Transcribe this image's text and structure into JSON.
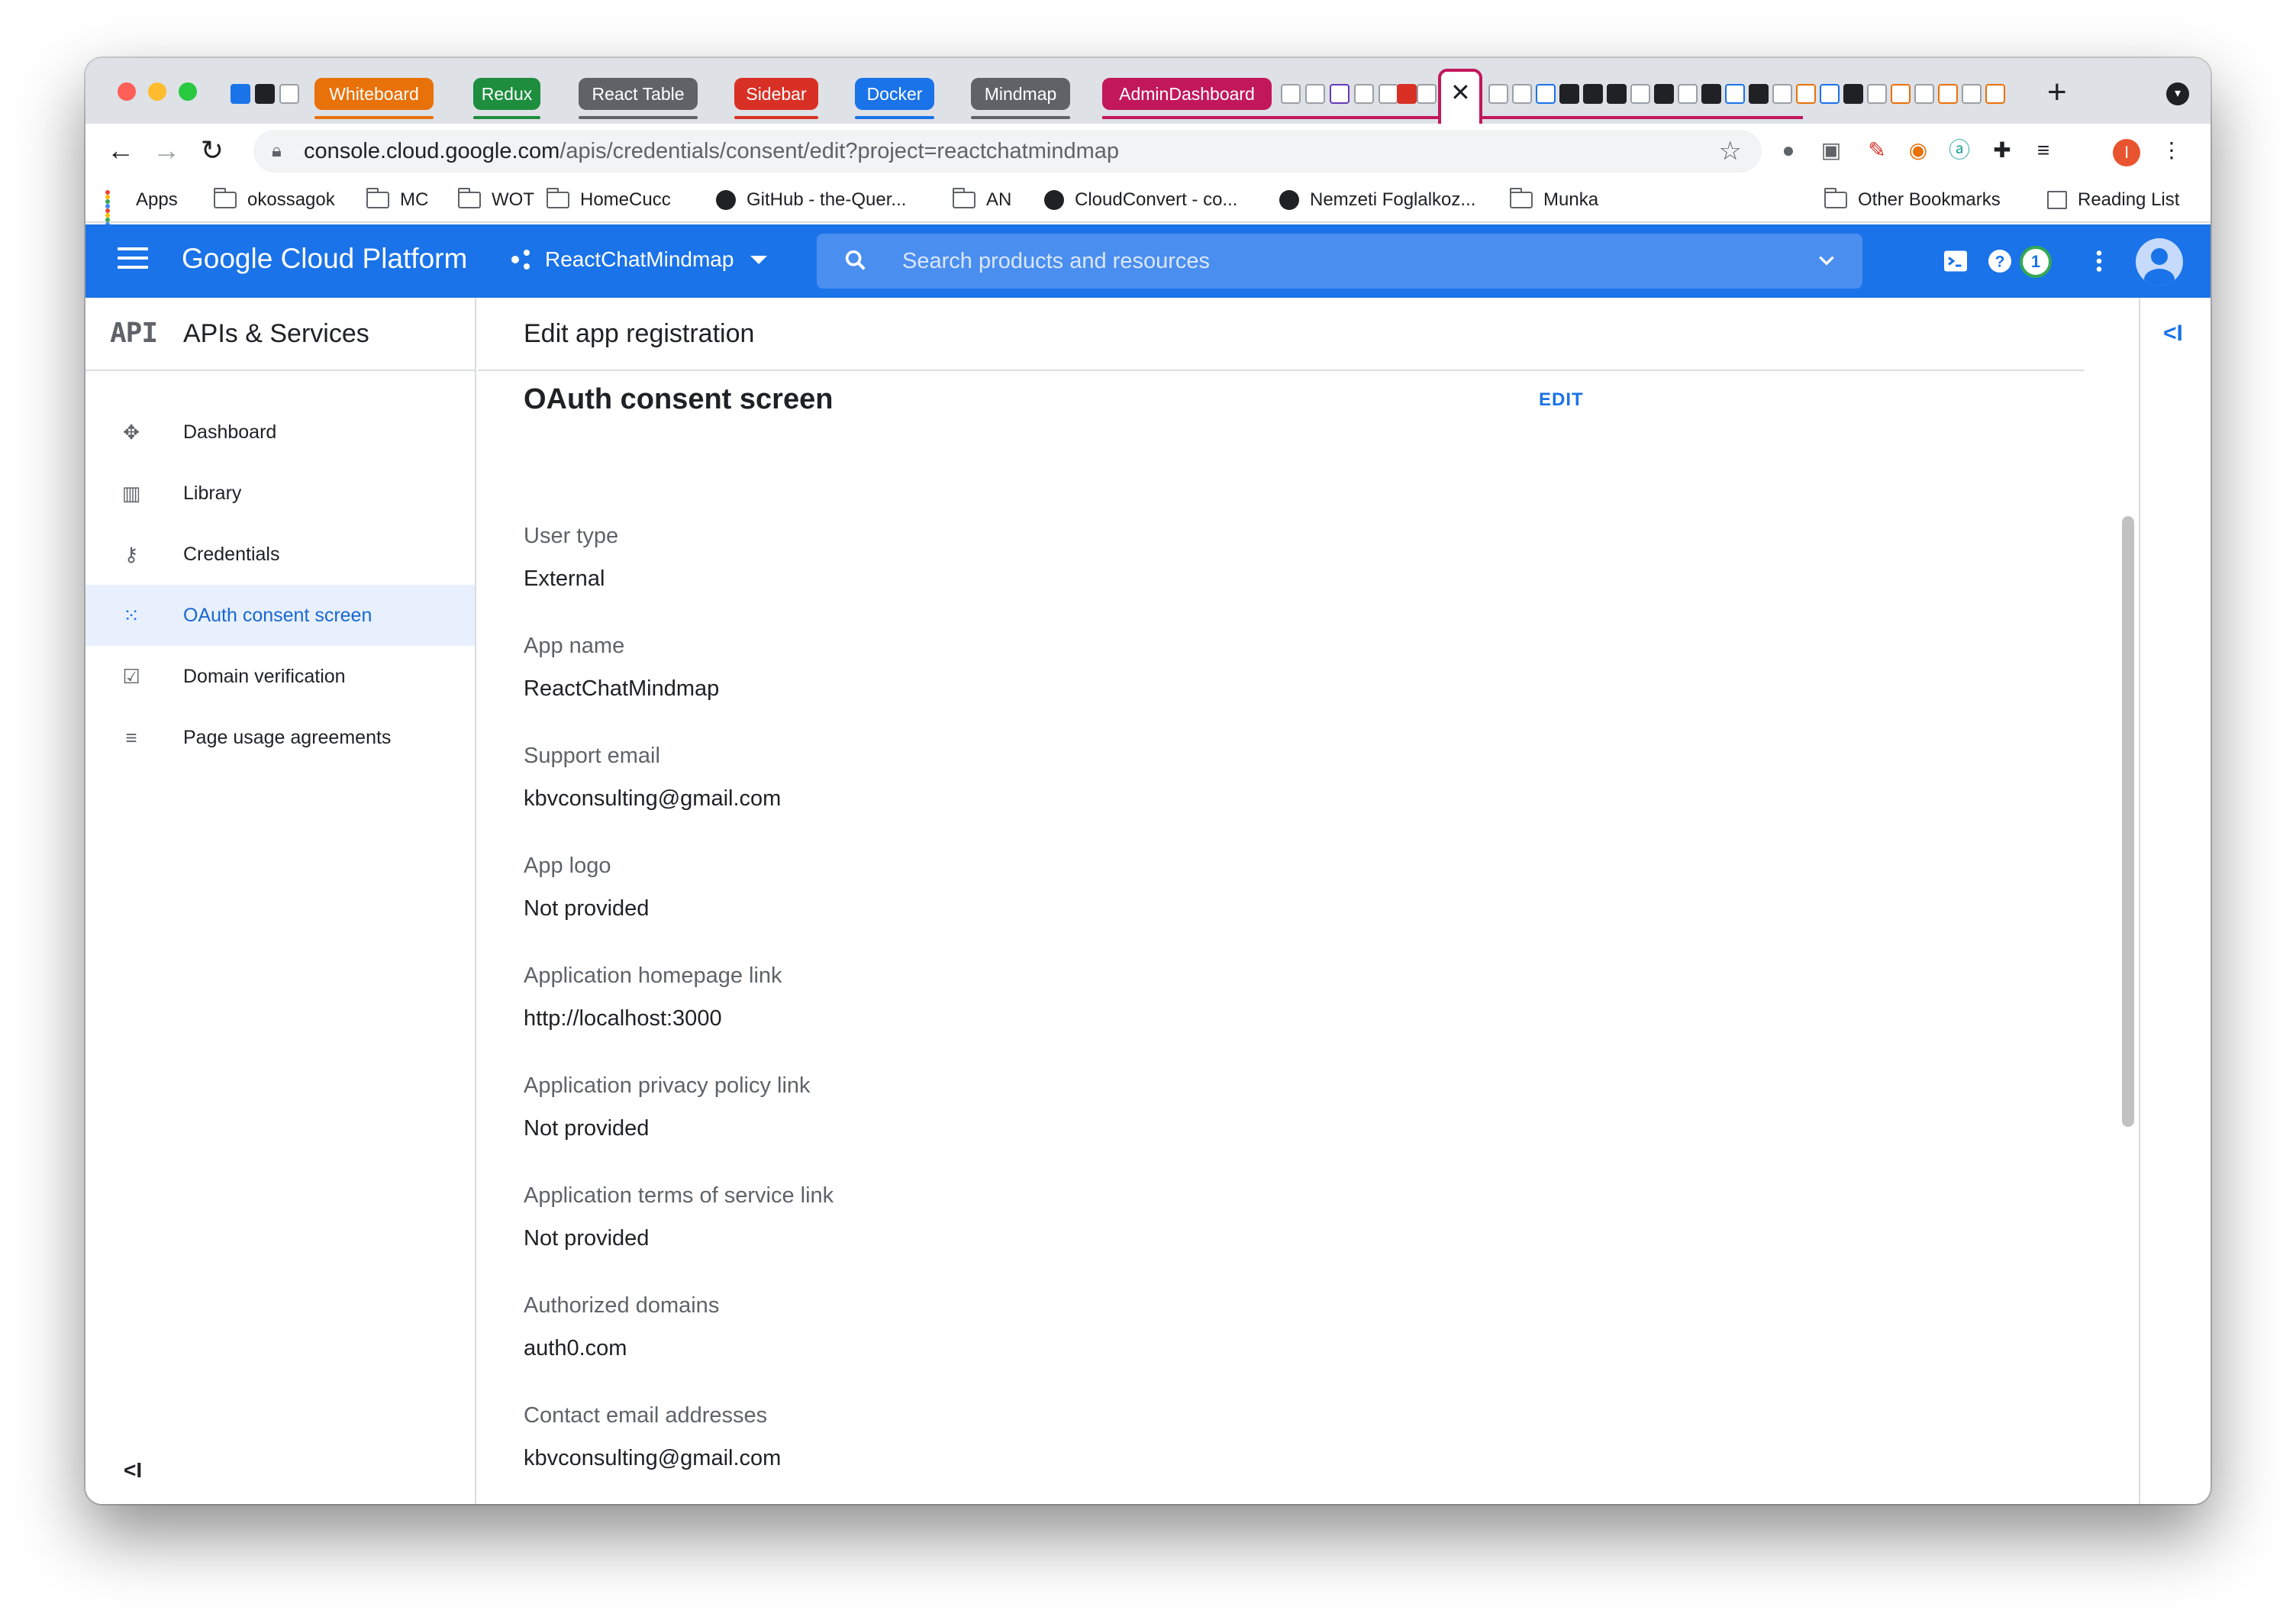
{
  "browser": {
    "tab_groups": [
      {
        "label": "Whiteboard",
        "color": "#e8710a"
      },
      {
        "label": "Redux",
        "color": "#1e8e3e"
      },
      {
        "label": "React Table",
        "color": "#5f6368"
      },
      {
        "label": "Sidebar",
        "color": "#d93025"
      },
      {
        "label": "Docker",
        "color": "#1a73e8"
      },
      {
        "label": "Mindmap",
        "color": "#5f6368"
      },
      {
        "label": "AdminDashboard",
        "color": "#c2185b"
      }
    ],
    "active_tab_close": "✕",
    "new_tab": "+",
    "url_host": "console.cloud.google.com",
    "url_path": "/apis/credentials/consent/edit?project=reactchatmindmap",
    "profile_initial": "I"
  },
  "bookmarks": [
    {
      "label": "Apps",
      "icon": "apps-icon"
    },
    {
      "label": "okossagok",
      "icon": "folder-icon"
    },
    {
      "label": "MC",
      "icon": "folder-icon"
    },
    {
      "label": "WOT",
      "icon": "folder-icon"
    },
    {
      "label": "HomeCucc",
      "icon": "folder-icon"
    },
    {
      "label": "GitHub - the-Quer...",
      "icon": "globe-icon"
    },
    {
      "label": "AN",
      "icon": "folder-icon"
    },
    {
      "label": "CloudConvert - co...",
      "icon": "globe-icon"
    },
    {
      "label": "Nemzeti Foglalkoz...",
      "icon": "globe-icon"
    },
    {
      "label": "Munka",
      "icon": "folder-icon"
    }
  ],
  "bookmarks_right": {
    "other": "Other Bookmarks",
    "reading": "Reading List"
  },
  "gcp": {
    "title": "Google Cloud Platform",
    "project": "ReactChatMindmap",
    "search_placeholder": "Search products and resources",
    "notification_count": "1",
    "brand_color": "#1a73e8"
  },
  "sidebar": {
    "logo": "API",
    "title": "APIs & Services",
    "items": [
      {
        "label": "Dashboard",
        "icon": "dashboard-icon",
        "active": false
      },
      {
        "label": "Library",
        "icon": "library-icon",
        "active": false
      },
      {
        "label": "Credentials",
        "icon": "key-icon",
        "active": false
      },
      {
        "label": "OAuth consent screen",
        "icon": "consent-icon",
        "active": true
      },
      {
        "label": "Domain verification",
        "icon": "checkbox-icon",
        "active": false
      },
      {
        "label": "Page usage agreements",
        "icon": "settings-list-icon",
        "active": false
      }
    ],
    "collapse": "<I"
  },
  "main": {
    "page_title": "Edit app registration",
    "section_title": "OAuth consent screen",
    "edit_label": "EDIT",
    "fields": [
      {
        "label": "User type",
        "value": "External"
      },
      {
        "label": "App name",
        "value": "ReactChatMindmap"
      },
      {
        "label": "Support email",
        "value": "kbvconsulting@gmail.com"
      },
      {
        "label": "App logo",
        "value": "Not provided"
      },
      {
        "label": "Application homepage link",
        "value": "http://localhost:3000"
      },
      {
        "label": "Application privacy policy link",
        "value": "Not provided"
      },
      {
        "label": "Application terms of service link",
        "value": "Not provided"
      },
      {
        "label": "Authorized domains",
        "value": "auth0.com"
      },
      {
        "label": "Contact email addresses",
        "value": "kbvconsulting@gmail.com"
      }
    ]
  },
  "right_rail": {
    "toggle": "<I"
  }
}
